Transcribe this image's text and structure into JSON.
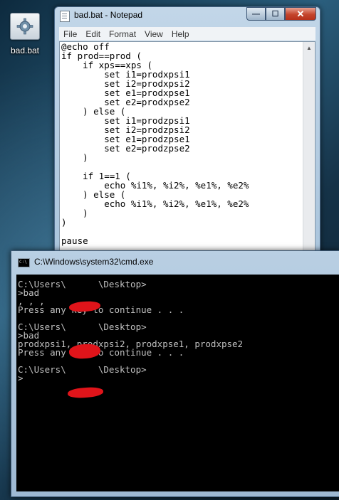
{
  "desktop": {
    "icon_label": "bad.bat",
    "icon_name": "batch-file-gear-icon"
  },
  "notepad": {
    "title": "bad.bat - Notepad",
    "menu": [
      "File",
      "Edit",
      "Format",
      "View",
      "Help"
    ],
    "lines": [
      "@echo off",
      "if prod==prod (",
      "    if xps==xps (",
      "        set i1=prodxpsi1",
      "        set i2=prodxpsi2",
      "        set e1=prodxpse1",
      "        set e2=prodxpse2",
      "    ) else (",
      "        set i1=prodzpsi1",
      "        set i2=prodzpsi2",
      "        set e1=prodzpse1",
      "        set e2=prodzpse2",
      "    )",
      "",
      "    if 1==1 (",
      "        echo %i1%, %i2%, %e1%, %e2%",
      "    ) else (",
      "        echo %i1%, %i2%, %e1%, %e2%",
      "    )",
      ")",
      "",
      "pause"
    ],
    "controls": {
      "minimize": "—",
      "maximize": "☐",
      "close": "✕"
    }
  },
  "cmd": {
    "title": "C:\\Windows\\system32\\cmd.exe",
    "lines": [
      "C:\\Users\\      \\Desktop>",
      ">bad",
      ", , ,",
      "Press any key to continue . . .",
      "",
      "C:\\Users\\      \\Desktop>",
      ">bad",
      "prodxpsi1, prodxpsi2, prodxpse1, prodxpse2",
      "Press any key to continue . . .",
      "",
      "C:\\Users\\      \\Desktop>",
      ">"
    ]
  },
  "colors": {
    "console_text": "#c0c0c0",
    "console_bg": "#000000",
    "redaction": "#e0141a"
  }
}
